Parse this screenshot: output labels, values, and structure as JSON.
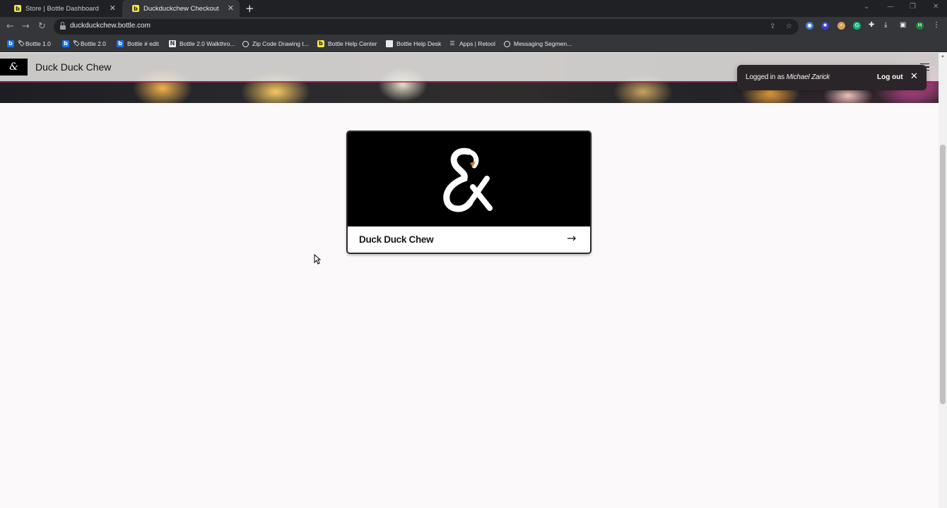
{
  "browser": {
    "tabs": [
      {
        "title": "Store | Bottle Dashboard",
        "active": false
      },
      {
        "title": "Duckduckchew Checkout",
        "active": true
      }
    ],
    "url": "duckduckchew.bottle.com",
    "bookmarks": [
      {
        "label": "Bottle 1.0",
        "icon": "bottle-b-icon"
      },
      {
        "label": "Bottle 2.0",
        "icon": "bottle-b-icon"
      },
      {
        "label": "Bottle # edit",
        "icon": "bottle-b-icon"
      },
      {
        "label": "Bottle 2.0 Walkthro...",
        "icon": "notion-icon"
      },
      {
        "label": "Zip Code Drawing t...",
        "icon": "globe-icon"
      },
      {
        "label": "Bottle Help Center",
        "icon": "bottle-yellow-icon"
      },
      {
        "label": "Bottle Help Desk",
        "icon": "document-icon"
      },
      {
        "label": "Apps | Retool",
        "icon": "retool-icon"
      },
      {
        "label": "Messaging Segmen...",
        "icon": "globe-icon"
      }
    ],
    "profile_initial": "M"
  },
  "site": {
    "title": "Duck Duck Chew",
    "logo_glyph": "&"
  },
  "toast": {
    "prefix": "Logged in as ",
    "user": "Michael Zarick",
    "logout_label": "Log out",
    "close_glyph": "✕"
  },
  "store_card": {
    "name": "Duck Duck Chew",
    "arrow_glyph": "→"
  },
  "colors": {
    "accent": "#c2185b",
    "toast_bg": "#2a2528",
    "chrome_dark": "#202124"
  }
}
